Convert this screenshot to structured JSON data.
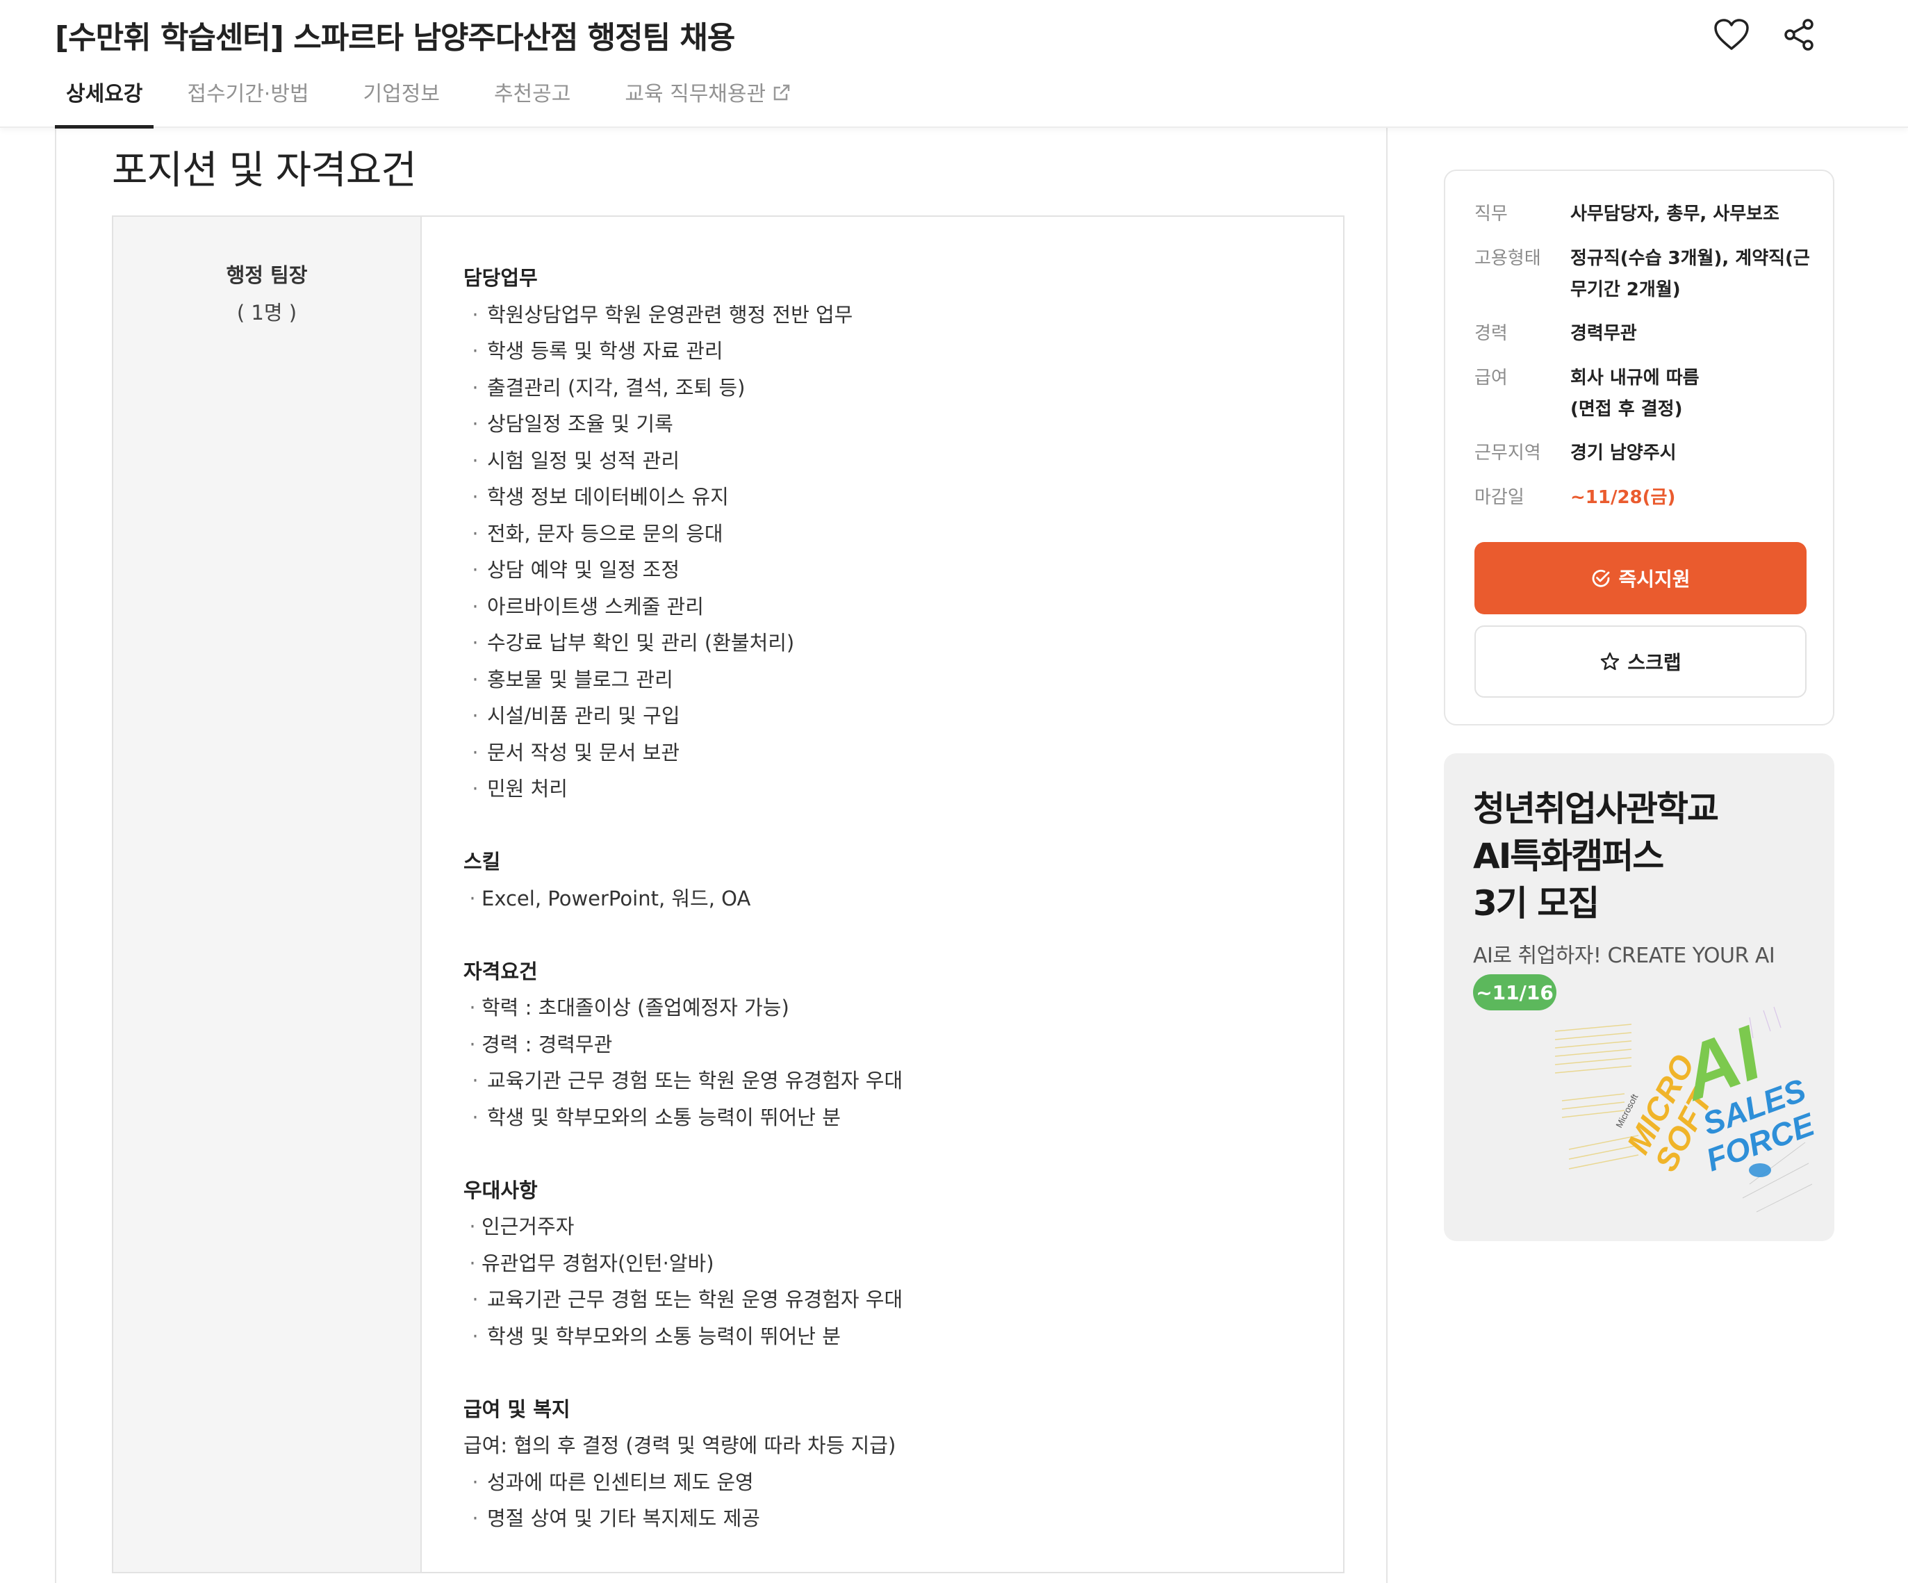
{
  "header": {
    "title": "[수만휘 학습센터] 스파르타 남양주다산점 행정팀 채용",
    "tabs": [
      "상세요강",
      "접수기간·방법",
      "기업정보",
      "추천공고",
      "교육 직무채용관"
    ],
    "heart_icon": "heart-icon",
    "share_icon": "share-icon",
    "external_icon": "external-link-icon"
  },
  "section": {
    "title": "포지션 및 자격요건",
    "position_name": "행정 팀장",
    "position_count": "( 1명 )"
  },
  "details": {
    "duties": {
      "title": "담당업무",
      "items": [
        "학원상담업무 학원 운영관련 행정 전반 업무",
        "학생 등록 및 학생 자료 관리",
        "출결관리 (지각, 결석, 조퇴 등)",
        "상담일정 조율 및 기록",
        "시험 일정 및 성적 관리",
        "학생 정보 데이터베이스 유지",
        "전화, 문자 등으로 문의 응대",
        "상담 예약 및 일정 조정",
        "아르바이트생 스케줄 관리",
        "수강료 납부 확인 및 관리 (환불처리)",
        "홍보물 및 블로그 관리",
        "시설/비품 관리 및 구입",
        "문서 작성 및 문서 보관",
        "민원 처리"
      ]
    },
    "skills": {
      "title": "스킬",
      "items": [
        "Excel, PowerPoint, 워드, OA"
      ]
    },
    "requirements": {
      "title": "자격요건",
      "items_tight": [
        "학력 : 초대졸이상 (졸업예정자 가능)",
        "경력 : 경력무관"
      ],
      "items": [
        "교육기관 근무 경험 또는 학원 운영 유경험자 우대",
        "학생 및 학부모와의 소통 능력이 뛰어난 분"
      ]
    },
    "preferred": {
      "title": "우대사항",
      "items_tight": [
        "인근거주자",
        "유관업무 경험자(인턴·알바)"
      ],
      "items": [
        "교육기관 근무 경험 또는 학원 운영 유경험자 우대",
        "학생 및 학부모와의 소통 능력이 뛰어난 분"
      ]
    },
    "benefits": {
      "title": "급여 및 복지",
      "intro": "급여: 협의 후 결정 (경력 및 역량에 따라 차등 지급)",
      "items": [
        "성과에 따른 인센티브 제도 운영",
        "명절 상여 및 기타 복지제도 제공"
      ]
    }
  },
  "summary": {
    "job_label": "직무",
    "job_value": "사무담당자, 총무, 사무보조",
    "type_label": "고용형태",
    "type_value_1": "정규직(수습 3개월), 계약직(근",
    "type_value_2": "무기간 2개월)",
    "career_label": "경력",
    "career_value": "경력무관",
    "salary_label": "급여",
    "salary_value_1": "회사 내규에 따름",
    "salary_value_2": "(면접 후 결정)",
    "location_label": "근무지역",
    "location_value": "경기 남양주시",
    "deadline_label": "마감일",
    "deadline_value": "~11/28(금)",
    "apply_label": "즉시지원",
    "scrap_label": "스크랩",
    "apply_icon": "check-circle-icon",
    "scrap_icon": "star-icon",
    "accent_color": "#ea5b2e"
  },
  "banner": {
    "line1": "청년취업사관학교",
    "line2": "AI특화캠퍼스",
    "line3": "3기 모집",
    "subtitle": "AI로 취업하자! CREATE YOUR AI",
    "badge": "~11/16",
    "art_text_1": "MICRO",
    "art_text_2": "SOFT",
    "art_text_3": "AI",
    "art_text_4": "SALES",
    "art_text_5": "FORCE",
    "art_text_6": "Microsoft",
    "badge_color": "#5cb85c"
  }
}
